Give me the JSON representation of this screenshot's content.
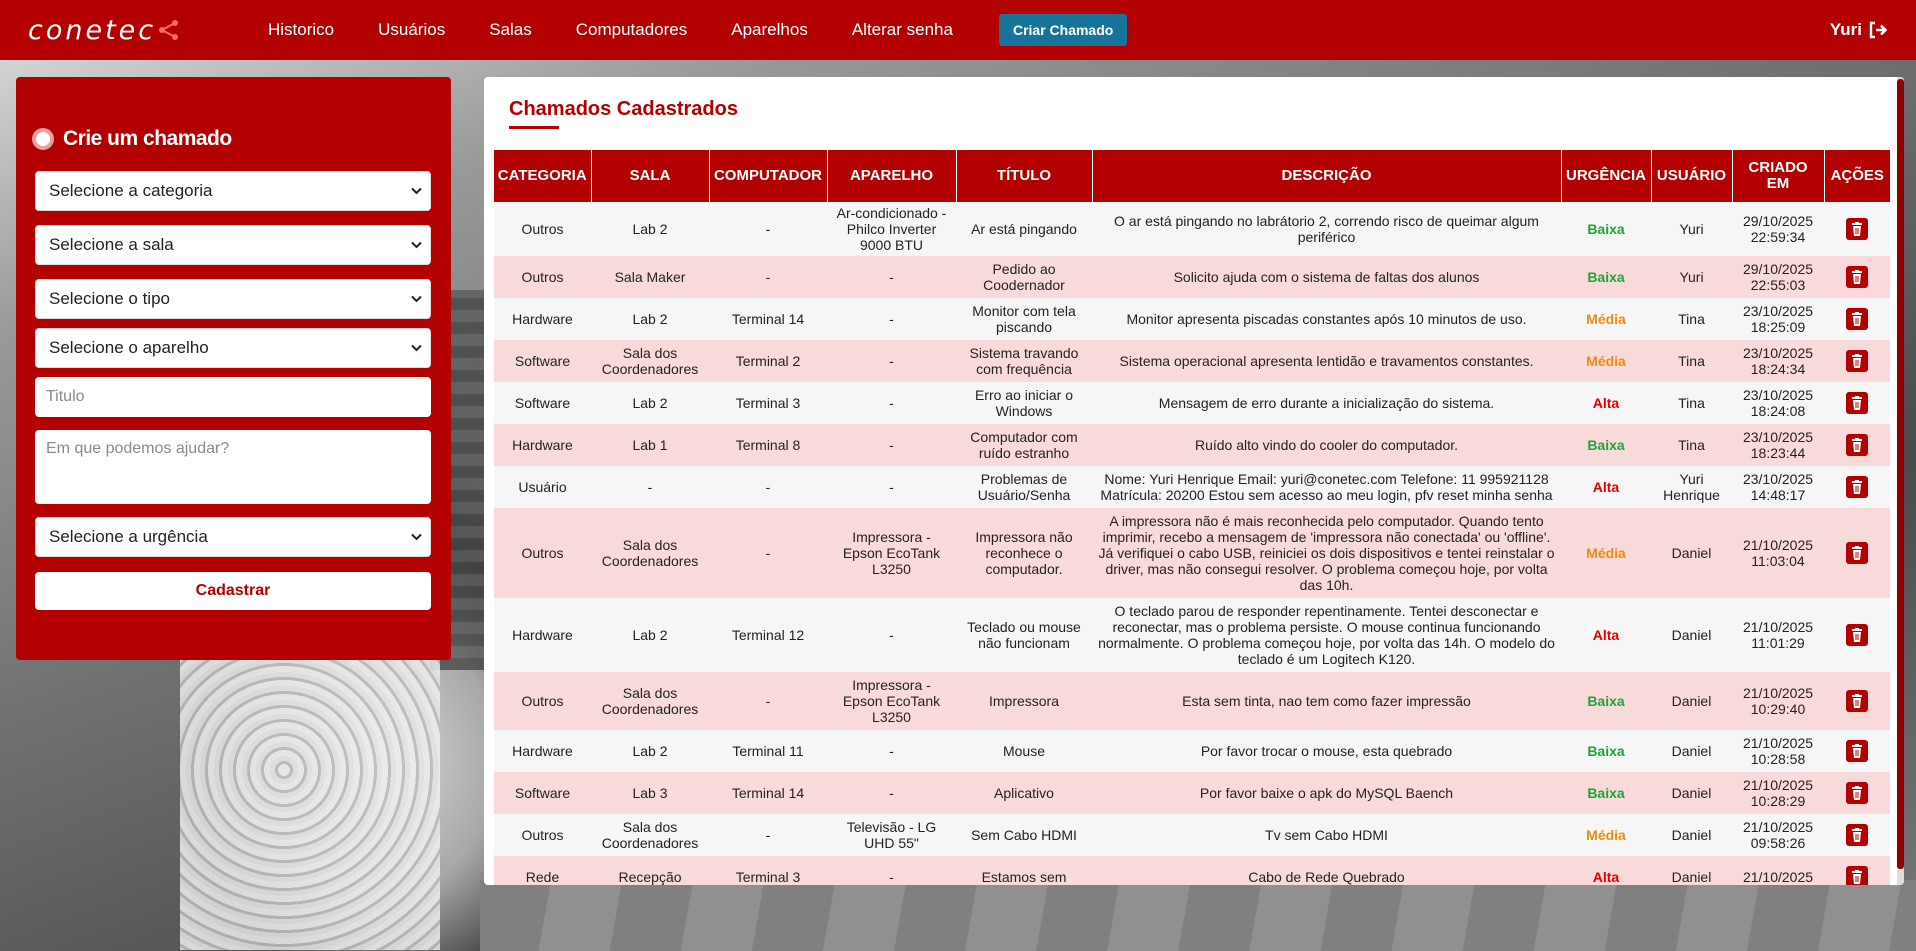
{
  "brand": {
    "logo_text": "conetec",
    "colors": {
      "primary": "#b30000",
      "cta": "#17739a",
      "baixa": "#1ea33a",
      "media": "#ef8c0e",
      "alta": "#e00000"
    }
  },
  "nav": {
    "links": [
      "Historico",
      "Usuários",
      "Salas",
      "Computadores",
      "Aparelhos",
      "Alterar senha"
    ],
    "cta": "Criar Chamado",
    "user": "Yuri",
    "logout_icon": "logout-icon"
  },
  "form": {
    "title": "Crie um chamado",
    "category_select": "Selecione a categoria",
    "room_select": "Selecione a sala",
    "type_select": "Selecione o tipo",
    "device_select": "Selecione o aparelho",
    "title_placeholder": "Titulo",
    "description_placeholder": "Em que podemos ajudar?",
    "urgency_select": "Selecione a urgência",
    "submit": "Cadastrar"
  },
  "table": {
    "title": "Chamados Cadastrados",
    "headers": [
      "CATEGORIA",
      "SALA",
      "COMPUTADOR",
      "APARELHO",
      "TÍTULO",
      "DESCRIÇÃO",
      "URGÊNCIA",
      "USUÁRIO",
      "CRIADO EM",
      "AÇÕES"
    ],
    "rows": [
      {
        "categoria": "Outros",
        "sala": "Lab 2",
        "computador": "-",
        "aparelho": "Ar-condicionado - Philco Inverter 9000 BTU",
        "titulo": "Ar está pingando",
        "descricao": "O ar está pingando no labrátorio 2, correndo risco de queimar algum periférico",
        "urgencia": "Baixa",
        "usuario": "Yuri",
        "data": "29/10/2025",
        "hora": "22:59:34"
      },
      {
        "categoria": "Outros",
        "sala": "Sala Maker",
        "computador": "-",
        "aparelho": "-",
        "titulo": "Pedido ao Coodernador",
        "descricao": "Solicito ajuda com o sistema de faltas dos alunos",
        "urgencia": "Baixa",
        "usuario": "Yuri",
        "data": "29/10/2025",
        "hora": "22:55:03"
      },
      {
        "categoria": "Hardware",
        "sala": "Lab 2",
        "computador": "Terminal 14",
        "aparelho": "-",
        "titulo": "Monitor com tela piscando",
        "descricao": "Monitor apresenta piscadas constantes após 10 minutos de uso.",
        "urgencia": "Média",
        "usuario": "Tina",
        "data": "23/10/2025",
        "hora": "18:25:09"
      },
      {
        "categoria": "Software",
        "sala": "Sala dos Coordenadores",
        "computador": "Terminal 2",
        "aparelho": "-",
        "titulo": "Sistema travando com frequência",
        "descricao": "Sistema operacional apresenta lentidão e travamentos constantes.",
        "urgencia": "Média",
        "usuario": "Tina",
        "data": "23/10/2025",
        "hora": "18:24:34"
      },
      {
        "categoria": "Software",
        "sala": "Lab 2",
        "computador": "Terminal 3",
        "aparelho": "-",
        "titulo": "Erro ao iniciar o Windows",
        "descricao": "Mensagem de erro durante a inicialização do sistema.",
        "urgencia": "Alta",
        "usuario": "Tina",
        "data": "23/10/2025",
        "hora": "18:24:08"
      },
      {
        "categoria": "Hardware",
        "sala": "Lab 1",
        "computador": "Terminal 8",
        "aparelho": "-",
        "titulo": "Computador com ruído estranho",
        "descricao": "Ruído alto vindo do cooler do computador.",
        "urgencia": "Baixa",
        "usuario": "Tina",
        "data": "23/10/2025",
        "hora": "18:23:44"
      },
      {
        "categoria": "Usuário",
        "sala": "-",
        "computador": "-",
        "aparelho": "-",
        "titulo": "Problemas de Usuário/Senha",
        "descricao": "Nome: Yuri Henrique Email: yuri@conetec.com Telefone: 11 995921128 Matrícula: 20200 Estou sem acesso ao meu login, pfv reset minha senha",
        "urgencia": "Alta",
        "usuario": "Yuri Henrique",
        "data": "23/10/2025",
        "hora": "14:48:17"
      },
      {
        "categoria": "Outros",
        "sala": "Sala dos Coordenadores",
        "computador": "-",
        "aparelho": "Impressora - Epson EcoTank L3250",
        "titulo": "Impressora não reconhece o computador.",
        "descricao": "A impressora não é mais reconhecida pelo computador. Quando tento imprimir, recebo a mensagem de 'impressora não conectada' ou 'offline'. Já verifiquei o cabo USB, reiniciei os dois dispositivos e tentei reinstalar o driver, mas não consegui resolver. O problema começou hoje, por volta das 10h.",
        "urgencia": "Média",
        "usuario": "Daniel",
        "data": "21/10/2025",
        "hora": "11:03:04"
      },
      {
        "categoria": "Hardware",
        "sala": "Lab 2",
        "computador": "Terminal 12",
        "aparelho": "-",
        "titulo": "Teclado ou mouse não funcionam",
        "descricao": "O teclado parou de responder repentinamente. Tentei desconectar e reconectar, mas o problema persiste. O mouse continua funcionando normalmente. O problema começou hoje, por volta das 14h. O modelo do teclado é um Logitech K120.",
        "urgencia": "Alta",
        "usuario": "Daniel",
        "data": "21/10/2025",
        "hora": "11:01:29"
      },
      {
        "categoria": "Outros",
        "sala": "Sala dos Coordenadores",
        "computador": "-",
        "aparelho": "Impressora - Epson EcoTank L3250",
        "titulo": "Impressora",
        "descricao": "Esta sem tinta, nao tem como fazer impressão",
        "urgencia": "Baixa",
        "usuario": "Daniel",
        "data": "21/10/2025",
        "hora": "10:29:40"
      },
      {
        "categoria": "Hardware",
        "sala": "Lab 2",
        "computador": "Terminal 11",
        "aparelho": "-",
        "titulo": "Mouse",
        "descricao": "Por favor trocar o mouse, esta quebrado",
        "urgencia": "Baixa",
        "usuario": "Daniel",
        "data": "21/10/2025",
        "hora": "10:28:58"
      },
      {
        "categoria": "Software",
        "sala": "Lab 3",
        "computador": "Terminal 14",
        "aparelho": "-",
        "titulo": "Aplicativo",
        "descricao": "Por favor baixe o apk do MySQL Baench",
        "urgencia": "Baixa",
        "usuario": "Daniel",
        "data": "21/10/2025",
        "hora": "10:28:29"
      },
      {
        "categoria": "Outros",
        "sala": "Sala dos Coordenadores",
        "computador": "-",
        "aparelho": "Televisão - LG UHD 55\"",
        "titulo": "Sem Cabo HDMI",
        "descricao": "Tv sem Cabo HDMI",
        "urgencia": "Média",
        "usuario": "Daniel",
        "data": "21/10/2025",
        "hora": "09:58:26"
      },
      {
        "categoria": "Rede",
        "sala": "Recepção",
        "computador": "Terminal 3",
        "aparelho": "-",
        "titulo": "Estamos sem",
        "descricao": "Cabo de Rede Quebrado",
        "urgencia": "Alta",
        "usuario": "Daniel",
        "data": "21/10/2025",
        "hora": ""
      }
    ]
  }
}
